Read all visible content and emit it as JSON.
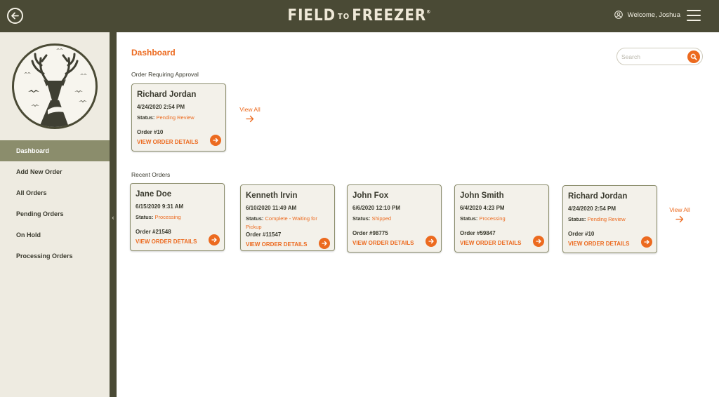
{
  "header": {
    "brand_big_1": "FIELD",
    "brand_small": "TO",
    "brand_big_2": "FREEZER",
    "brand_reg": "®",
    "welcome": "Welcome, Joshua"
  },
  "sidebar": {
    "items": [
      {
        "label": "Dashboard",
        "active": true
      },
      {
        "label": "Add New Order"
      },
      {
        "label": "All Orders"
      },
      {
        "label": "Pending Orders"
      },
      {
        "label": "On Hold"
      },
      {
        "label": "Processing Orders"
      }
    ]
  },
  "main": {
    "title": "Dashboard",
    "search_placeholder": "Search",
    "approval_label": "Order Requiring Approval",
    "recent_label": "Recent Orders",
    "view_all": "View All",
    "status_prefix": "Status:",
    "details_link": "VIEW ORDER DETAILS",
    "approval_cards": [
      {
        "name": "Richard Jordan",
        "date": "4/24/2020 2:54 PM",
        "status": "Pending Review",
        "order": "Order #10"
      }
    ],
    "recent_cards": [
      {
        "name": "Jane Doe",
        "date": "6/15/2020 9:31 AM",
        "status": "Processing",
        "order": "Order #21548"
      },
      {
        "name": "Kenneth Irvin",
        "date": "6/10/2020 11:49 AM",
        "status": "Complete - Waiting for Pickup",
        "order": "Order #11547"
      },
      {
        "name": "John Fox",
        "date": "6/6/2020 12:10 PM",
        "status": "Shipped",
        "order": "Order #98775"
      },
      {
        "name": "John Smith",
        "date": "6/4/2020 4:23 PM",
        "status": "Processing",
        "order": "Order #59847"
      },
      {
        "name": "Richard Jordan",
        "date": "4/24/2020 2:54 PM",
        "status": "Pending Review",
        "order": "Order #10"
      }
    ]
  },
  "colors": {
    "header_bg": "#4a4a35",
    "accent": "#ec6a1f",
    "sidebar_bg": "#eeebe1",
    "active_item": "#8b8d6c",
    "card_bg": "#f3f1ea"
  }
}
